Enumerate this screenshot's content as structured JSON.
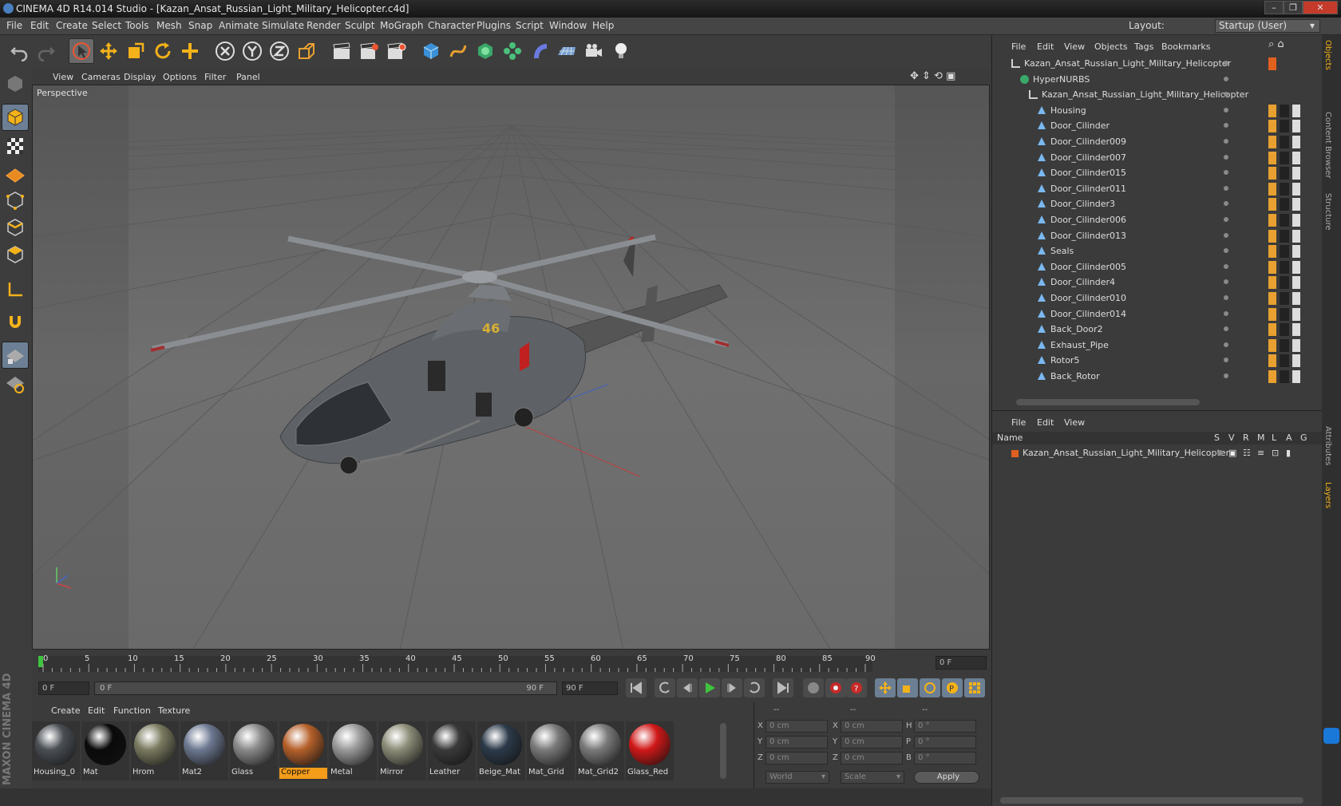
{
  "window": {
    "title": "CINEMA 4D R14.014 Studio - [Kazan_Ansat_Russian_Light_Military_Helicopter.c4d]"
  },
  "menu": [
    "File",
    "Edit",
    "Create",
    "Select",
    "Tools",
    "Mesh",
    "Snap",
    "Animate",
    "Simulate",
    "Render",
    "Sculpt",
    "MoGraph",
    "Character",
    "Plugins",
    "Script",
    "Window",
    "Help"
  ],
  "layout": {
    "label": "Layout:",
    "value": "Startup (User)"
  },
  "viewport": {
    "menu": [
      "View",
      "Cameras",
      "Display",
      "Options",
      "Filter",
      "Panel"
    ],
    "label": "Perspective",
    "overlay_text": "46"
  },
  "timeline": {
    "ticks": [
      "0",
      "5",
      "10",
      "15",
      "20",
      "25",
      "30",
      "35",
      "40",
      "45",
      "50",
      "55",
      "60",
      "65",
      "70",
      "75",
      "80",
      "85",
      "90"
    ],
    "current": "0 F",
    "start": "0 F",
    "range_start": "0 F",
    "range_end": "90 F",
    "end": "90 F"
  },
  "materials": {
    "menu": [
      "Create",
      "Edit",
      "Function",
      "Texture"
    ],
    "items": [
      {
        "name": "Housing_0",
        "color": "#4a4f55",
        "selected": false
      },
      {
        "name": "Mat",
        "color": "#0a0a0a",
        "selected": false
      },
      {
        "name": "Hrom",
        "color": "#7a7a60",
        "selected": false
      },
      {
        "name": "Mat2",
        "color": "#6c7890",
        "selected": false
      },
      {
        "name": "Glass",
        "color": "#8a8a8a",
        "selected": false
      },
      {
        "name": "Copper",
        "color": "#b5602a",
        "selected": true
      },
      {
        "name": "Metal",
        "color": "#9a9a9a",
        "selected": false
      },
      {
        "name": "Mirror",
        "color": "#8c8c78",
        "selected": false
      },
      {
        "name": "Leather",
        "color": "#3a3a3a",
        "selected": false
      },
      {
        "name": "Beige_Mat",
        "color": "#2c3a4a",
        "selected": false
      },
      {
        "name": "Mat_Grid",
        "color": "#7a7a7a",
        "selected": false
      },
      {
        "name": "Mat_Grid2",
        "color": "#7a7a7a",
        "selected": false
      },
      {
        "name": "Glass_Red",
        "color": "#d01818",
        "selected": false
      }
    ]
  },
  "coords": {
    "headers": [
      "--",
      "--",
      "--"
    ],
    "rows": [
      {
        "a": "X",
        "av": "0 cm",
        "b": "X",
        "bv": "0 cm",
        "c": "H",
        "cv": "0 °"
      },
      {
        "a": "Y",
        "av": "0 cm",
        "b": "Y",
        "bv": "0 cm",
        "c": "P",
        "cv": "0 °"
      },
      {
        "a": "Z",
        "av": "0 cm",
        "b": "Z",
        "bv": "0 cm",
        "c": "B",
        "cv": "0 °"
      }
    ],
    "mode1": "World",
    "mode2": "Scale",
    "apply": "Apply"
  },
  "objects": {
    "menu": [
      "File",
      "Edit",
      "View",
      "Objects",
      "Tags",
      "Bookmarks"
    ],
    "rows": [
      {
        "name": "Kazan_Ansat_Russian_Light_Military_Helicopter",
        "indent": 0
      },
      {
        "name": "HyperNURBS",
        "indent": 1
      },
      {
        "name": "Kazan_Ansat_Russian_Light_Military_Helicopter",
        "indent": 2
      },
      {
        "name": "Housing",
        "indent": 3
      },
      {
        "name": "Door_Cilinder",
        "indent": 3
      },
      {
        "name": "Door_Cilinder009",
        "indent": 3
      },
      {
        "name": "Door_Cilinder007",
        "indent": 3
      },
      {
        "name": "Door_Cilinder015",
        "indent": 3
      },
      {
        "name": "Door_Cilinder011",
        "indent": 3
      },
      {
        "name": "Door_Cilinder3",
        "indent": 3
      },
      {
        "name": "Door_Cilinder006",
        "indent": 3
      },
      {
        "name": "Door_Cilinder013",
        "indent": 3
      },
      {
        "name": "Seals",
        "indent": 3
      },
      {
        "name": "Door_Cilinder005",
        "indent": 3
      },
      {
        "name": "Door_Cilinder4",
        "indent": 3
      },
      {
        "name": "Door_Cilinder010",
        "indent": 3
      },
      {
        "name": "Door_Cilinder014",
        "indent": 3
      },
      {
        "name": "Back_Door2",
        "indent": 3
      },
      {
        "name": "Exhaust_Pipe",
        "indent": 3
      },
      {
        "name": "Rotor5",
        "indent": 3
      },
      {
        "name": "Back_Rotor",
        "indent": 3
      }
    ]
  },
  "layers": {
    "menu": [
      "File",
      "Edit",
      "View"
    ],
    "header": {
      "name": "Name",
      "cols": [
        "S",
        "V",
        "R",
        "M",
        "L",
        "A",
        "G"
      ]
    },
    "rows": [
      {
        "name": "Kazan_Ansat_Russian_Light_Military_Helicopter"
      }
    ]
  },
  "sidetabs": [
    "Objects",
    "Content Browser",
    "Structure",
    "Attributes",
    "Layers"
  ],
  "brand": "MAXON CINEMA 4D",
  "colors": {
    "accent": "#f39c1a",
    "panel": "#3b3b3b",
    "viewport": "#6b6b6b"
  }
}
